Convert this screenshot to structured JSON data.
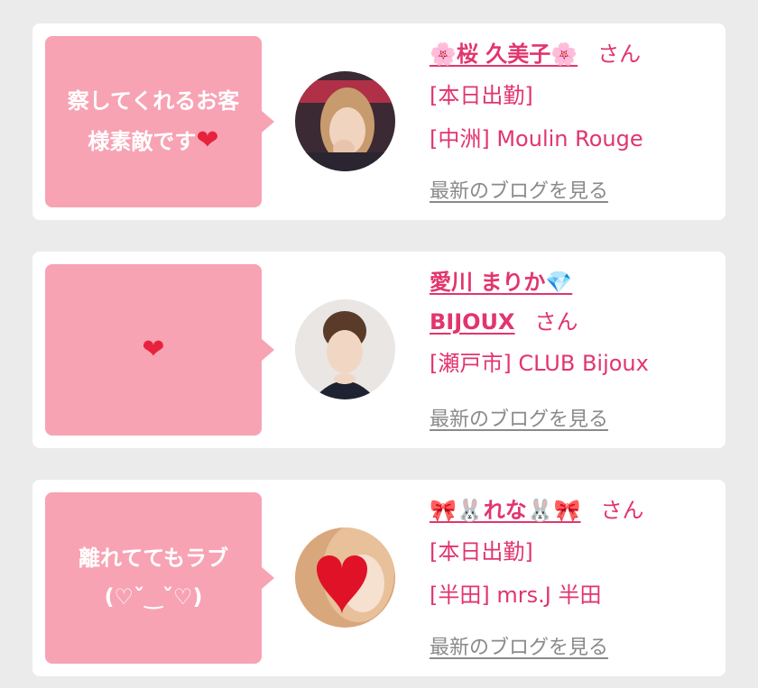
{
  "cards": [
    {
      "message_text": "察してくれるお客\n様素敵です",
      "message_heart": "❤",
      "name": "🌸桜 久美子🌸",
      "honorific": "さん",
      "status": "[本日出勤]",
      "shop": "[中洲] Moulin Rouge",
      "blog_link": "最新のブログを見る"
    },
    {
      "message_text": "",
      "message_heart": "❤",
      "name": "愛川 まりか💎",
      "name_second": "BIJOUX",
      "honorific": "さん",
      "shop": "[瀬戸市] CLUB Bijoux",
      "blog_link": "最新のブログを見る"
    },
    {
      "message_text": "離れててもラブ\n(♡ˇ‿ˇ♡)",
      "name": "🎀🐰れな🐰🎀",
      "honorific": "さん",
      "status": "[本日出勤]",
      "shop": "[半田] mrs.J 半田",
      "blog_link": "最新のブログを見る"
    }
  ],
  "colors": {
    "bubble": "#f7a3b4",
    "name": "#e2356d",
    "link": "#8a8a8a",
    "background": "#ebebeb"
  }
}
